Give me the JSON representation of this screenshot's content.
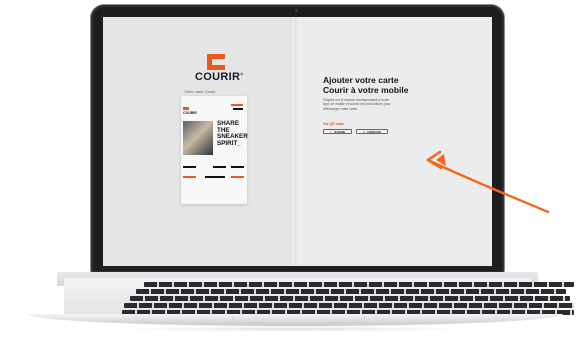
{
  "brand": {
    "name": "COURIR",
    "registered": "®",
    "tagline": "Votre carte Courir",
    "accent_color": "#e85b1a"
  },
  "card": {
    "logo_text": "COURIR",
    "headline_lines": [
      "SHARE",
      "THE",
      "SNEAKER",
      "SPIRIT_"
    ]
  },
  "panel": {
    "title_line1": "Ajouter votre carte",
    "title_line2": "Courir à votre mobile",
    "description": "Cliquez sur le bouton correspondant à votre type de mobile et suivez les instructions pour télécharger votre carte.",
    "qr_link": "Via QR code",
    "buttons": [
      {
        "label": "IPHONE",
        "icon": "apple-icon"
      },
      {
        "label": "ANDROID",
        "icon": "android-icon"
      }
    ]
  },
  "annotation": {
    "arrow_color": "#f26a1b"
  }
}
